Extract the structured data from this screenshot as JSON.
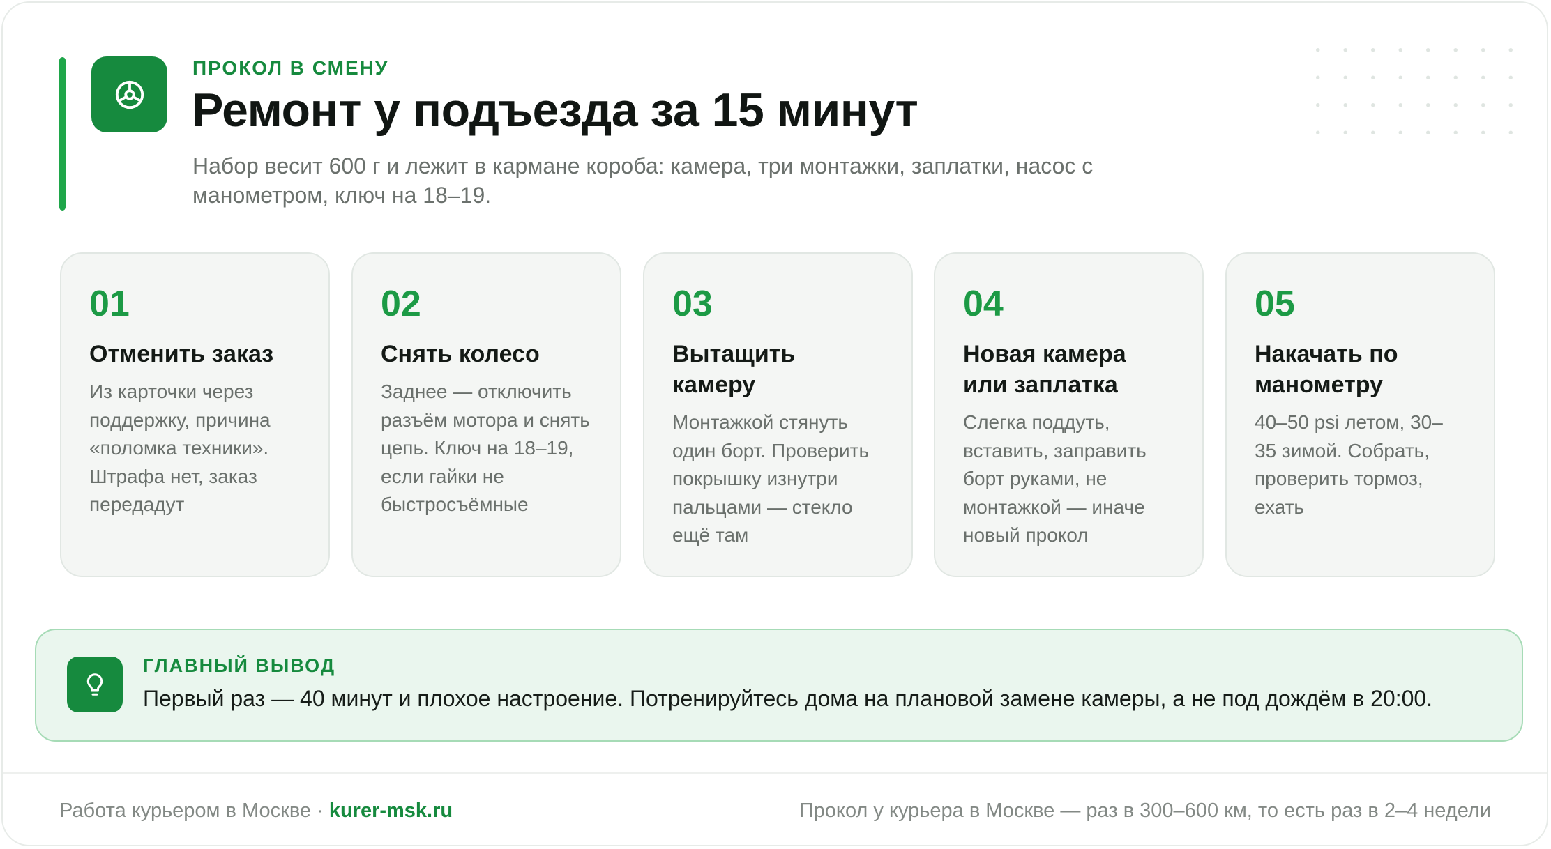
{
  "header": {
    "eyebrow": "ПРОКОЛ В СМЕНУ",
    "title": "Ремонт у подъезда за 15 минут",
    "subtitle": "Набор весит 600 г и лежит в кармане короба: камера, три монтажки, заплатки, насос с манометром, ключ на 18–19.",
    "icon": "wheel-icon"
  },
  "steps": [
    {
      "num": "01",
      "title": "Отменить заказ",
      "text": "Из карточки через поддержку, причина «поломка техники». Штрафа нет, заказ передадут"
    },
    {
      "num": "02",
      "title": "Снять колесо",
      "text": "Заднее — отключить разъём мотора и снять цепь. Ключ на 18–19, если гайки не быстросъёмные"
    },
    {
      "num": "03",
      "title": "Вытащить камеру",
      "text": "Монтажкой стянуть один борт. Проверить покрышку изнутри пальцами — стекло ещё там"
    },
    {
      "num": "04",
      "title": "Новая камера или заплатка",
      "text": "Слегка поддуть, вставить, заправить борт руками, не монтажкой — иначе новый прокол"
    },
    {
      "num": "05",
      "title": "Накачать по манометру",
      "text": "40–50 psi летом, 30–35 зимой. Собрать, проверить тормоз, ехать"
    }
  ],
  "takeaway": {
    "label": "ГЛАВНЫЙ ВЫВОД",
    "text": "Первый раз — 40 минут и плохое настроение. Потренируйтесь дома на плановой замене камеры, а не под дождём в 20:00.",
    "icon": "lightbulb-icon"
  },
  "footer": {
    "left_text": "Работа курьером в Москве · ",
    "site": "kurer-msk.ru",
    "right_text": "Прокол у курьера в Москве — раз в 300–600 км, то есть раз в 2–4 недели"
  },
  "colors": {
    "accent": "#168a3e",
    "accent_light": "#1fa64a",
    "takeaway_bg": "#eaf6ee",
    "card_bg": "#f4f6f4"
  }
}
